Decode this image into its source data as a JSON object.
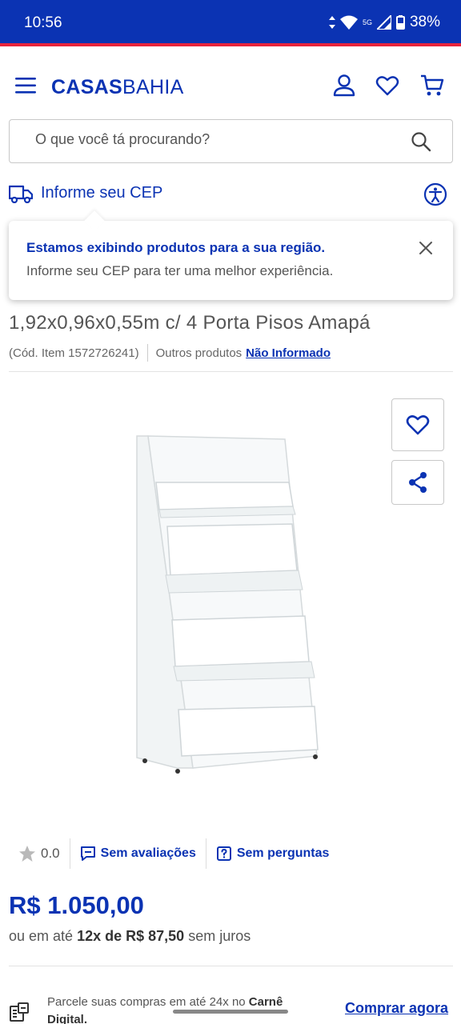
{
  "status_bar": {
    "time": "10:56",
    "network": "5G",
    "battery": "38%"
  },
  "header": {
    "logo_bold": "CASAS",
    "logo_regular": "BAHIA"
  },
  "search": {
    "placeholder": "O que você tá procurando?"
  },
  "cep": {
    "label": "Informe seu CEP"
  },
  "toast": {
    "title": "Estamos exibindo produtos para a sua região.",
    "message": "Informe seu CEP para ter uma melhor experiência."
  },
  "product": {
    "title": "1,92x0,96x0,55m c/ 4 Porta Pisos Amapá",
    "code": "(Cód. Item 1572726241)",
    "others_label": "Outros produtos",
    "brand_link": "Não Informado"
  },
  "rating": {
    "score": "0.0",
    "reviews": "Sem avaliações",
    "questions": "Sem perguntas"
  },
  "price": {
    "value": "R$ 1.050,00",
    "prefix": "ou em até",
    "installments": "12x de R$ 87,50",
    "suffix": "sem juros"
  },
  "carne": {
    "text_start": "Parcele suas compras em até 24x no",
    "text_bold": "Carnê Digital.",
    "link": "Comprar agora"
  },
  "colors": {
    "brand_blue": "#0b33b3",
    "accent_red": "#e8243c"
  }
}
